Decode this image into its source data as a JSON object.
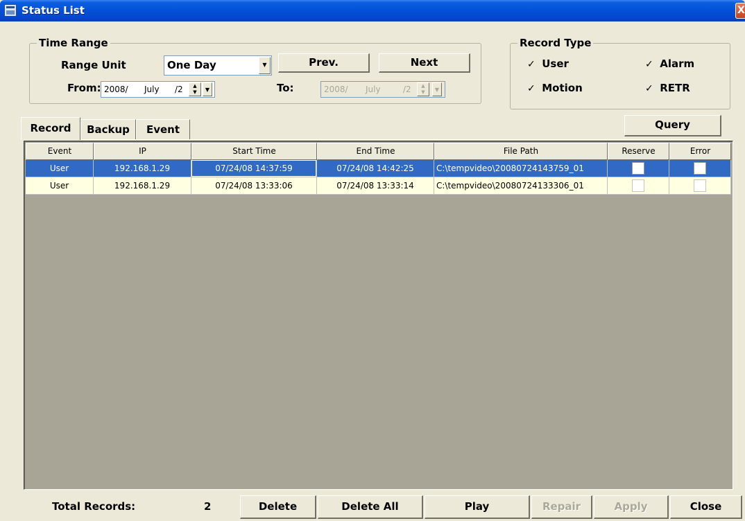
{
  "window": {
    "title": "Status List",
    "close_glyph": "X"
  },
  "time_range": {
    "label": "Time Range",
    "range_unit_label": "Range Unit",
    "range_unit_value": "One Day",
    "prev_label": "Prev.",
    "next_label": "Next",
    "from_label": "From:",
    "to_label": "To:",
    "from_year": "2008/",
    "from_month": "July",
    "from_day": "/2",
    "to_year": "2008/",
    "to_month": "July",
    "to_day": "/2"
  },
  "record_type": {
    "label": "Record Type",
    "options": [
      {
        "label": "User",
        "checked": true
      },
      {
        "label": "Alarm",
        "checked": true
      },
      {
        "label": "Motion",
        "checked": true
      },
      {
        "label": "RETR",
        "checked": true
      }
    ]
  },
  "tabs": [
    {
      "label": "Record",
      "active": true
    },
    {
      "label": "Backup",
      "active": false
    },
    {
      "label": "Event",
      "active": false
    }
  ],
  "query_label": "Query",
  "table": {
    "columns": [
      "Event",
      "IP",
      "Start Time",
      "End Time",
      "File Path",
      "Reserve",
      "Error"
    ],
    "rows": [
      {
        "event": "User",
        "ip": "192.168.1.29",
        "start": "07/24/08 14:37:59",
        "end": "07/24/08 14:42:25",
        "path": "C:\\tempvideo\\20080724143759_01",
        "reserve": false,
        "error": false,
        "selected": true
      },
      {
        "event": "User",
        "ip": "192.168.1.29",
        "start": "07/24/08 13:33:06",
        "end": "07/24/08 13:33:14",
        "path": "C:\\tempvideo\\20080724133306_01",
        "reserve": false,
        "error": false,
        "selected": false
      }
    ]
  },
  "footer": {
    "total_label": "Total Records:",
    "total_value": "2",
    "delete_label": "Delete",
    "delete_all_label": "Delete All",
    "play_label": "Play",
    "repair_label": "Repair",
    "apply_label": "Apply",
    "close_label": "Close"
  },
  "check_glyph": "☑",
  "checkmark": "✓",
  "icons": [
    "app-icon",
    "close-icon",
    "dropdown-arrow-icon",
    "spin-icon"
  ]
}
